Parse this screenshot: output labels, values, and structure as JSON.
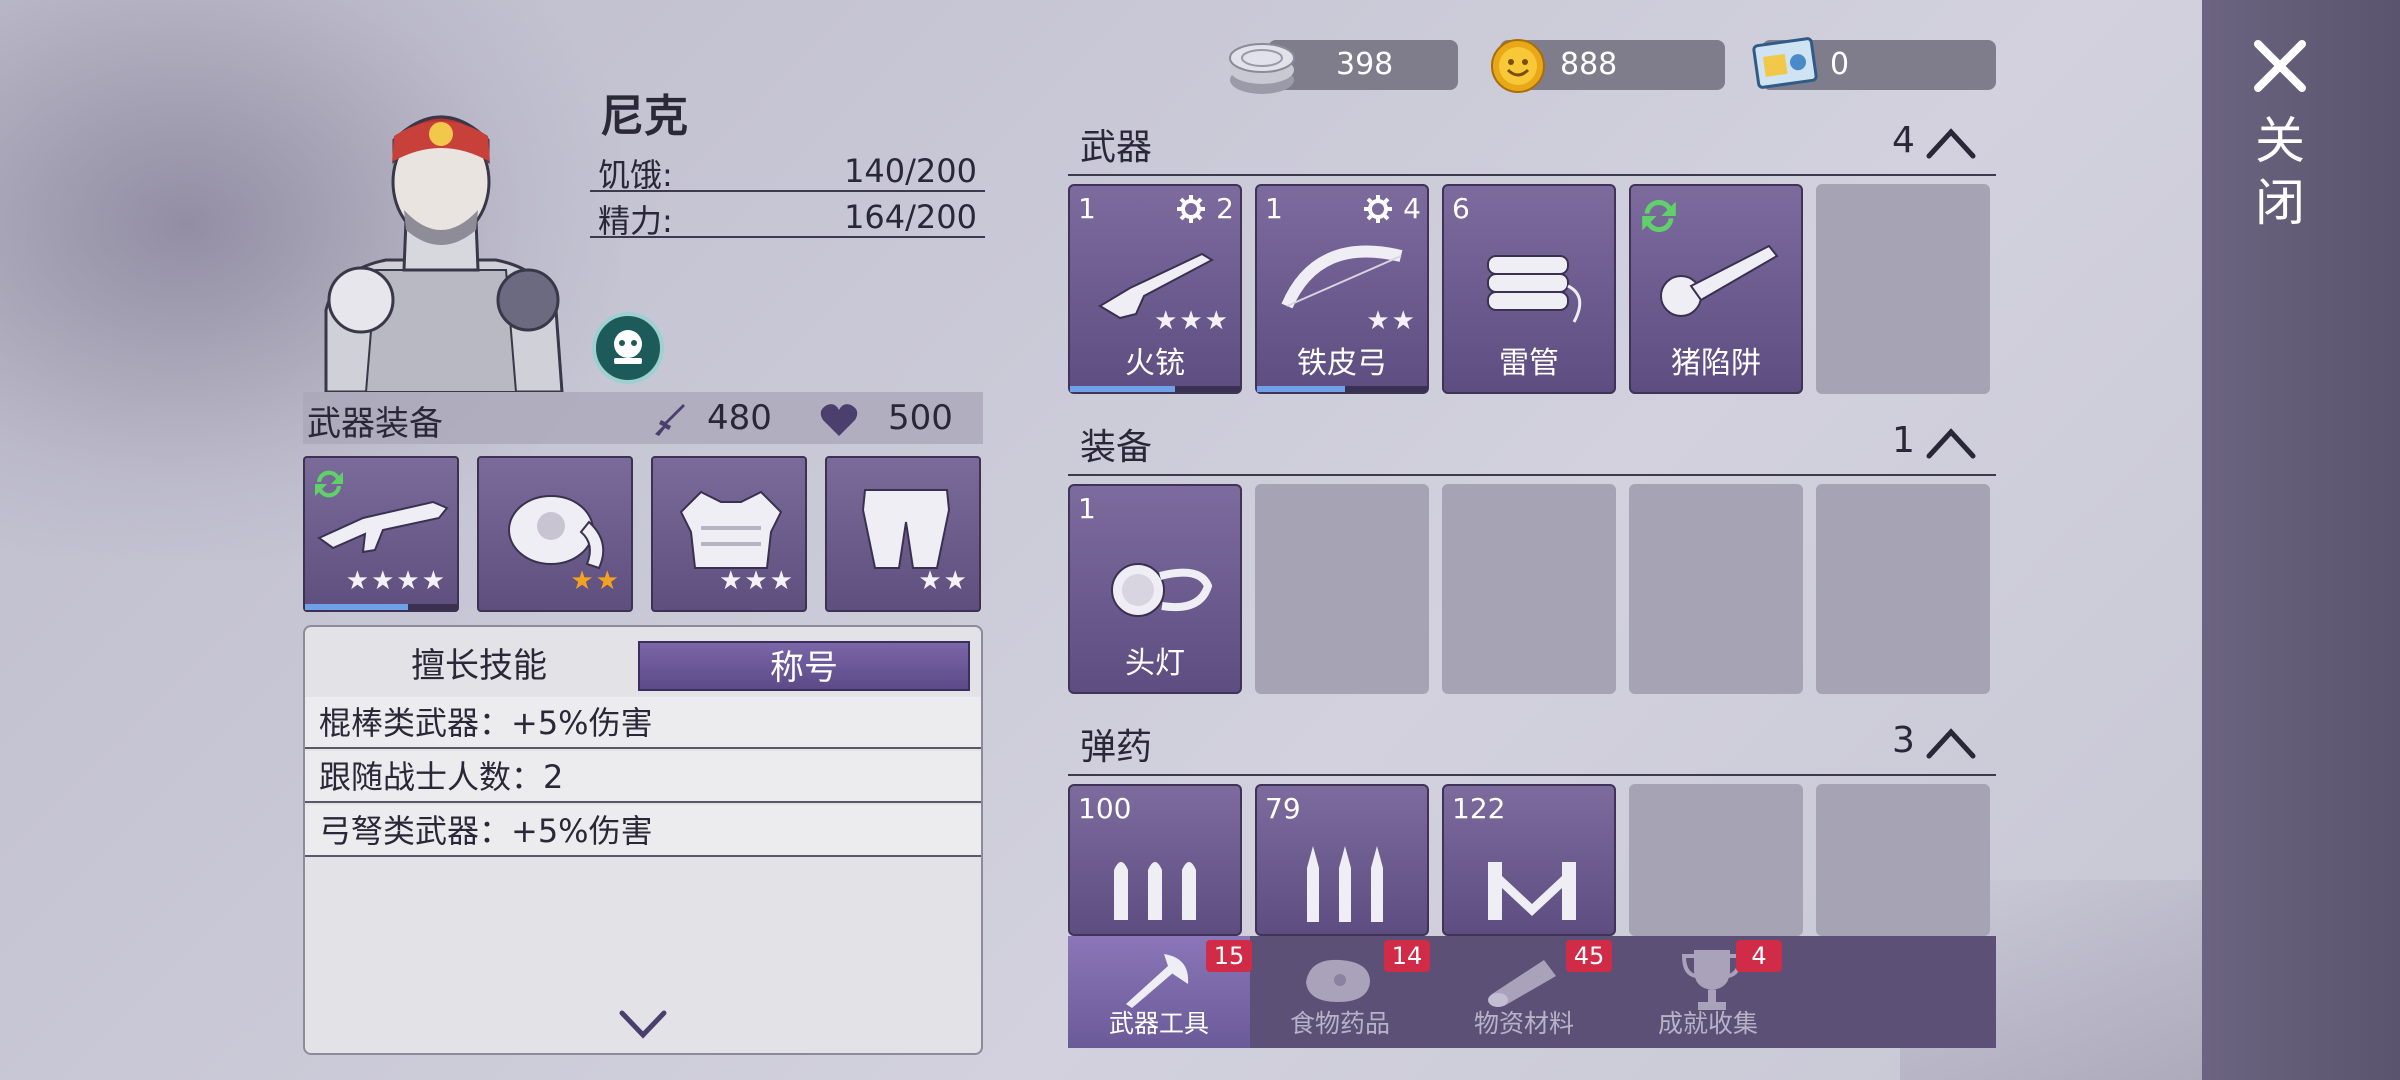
{
  "currencies": [
    {
      "name": "silver-coin",
      "value": "398"
    },
    {
      "name": "gold-coin",
      "value": "888"
    },
    {
      "name": "ticket",
      "value": "0"
    }
  ],
  "close_label": "关闭",
  "hero": {
    "name": "尼克",
    "hunger_label": "饥饿:",
    "hunger_value": "140/200",
    "energy_label": "精力:",
    "energy_value": "164/200"
  },
  "equipment": {
    "title": "武器装备",
    "attack": "480",
    "health": "500",
    "slots": [
      {
        "item": "rifle",
        "stars": "★★★★",
        "star_color": "#f0eef5",
        "progress": 0.68
      },
      {
        "item": "headband",
        "stars": "★★",
        "star_color": "#f2a21e"
      },
      {
        "item": "vest",
        "stars": "★★★",
        "star_color": "#f0eef5"
      },
      {
        "item": "pants",
        "stars": "★★",
        "star_color": "#f0eef5"
      }
    ]
  },
  "skills_panel": {
    "tab_skills": "擅长技能",
    "tab_title": "称号",
    "rows": [
      "棍棒类武器：+5%伤害",
      "跟随战士人数：2",
      "弓弩类武器：+5%伤害"
    ]
  },
  "inventory": {
    "weapons": {
      "title": "武器",
      "count": "4",
      "items": [
        {
          "num": "1",
          "level": "2",
          "name": "火铳",
          "stars": "★★★",
          "progress": 0.62
        },
        {
          "num": "1",
          "level": "4",
          "name": "铁皮弓",
          "stars": "★★",
          "progress": 0.52
        },
        {
          "num": "6",
          "name": "雷管"
        },
        {
          "name": "猪陷阱"
        }
      ]
    },
    "gear": {
      "title": "装备",
      "count": "1",
      "items": [
        {
          "num": "1",
          "name": "头灯"
        }
      ]
    },
    "ammo": {
      "title": "弹药",
      "count": "3",
      "items": [
        {
          "num": "100"
        },
        {
          "num": "79"
        },
        {
          "num": "122"
        }
      ]
    }
  },
  "nav": [
    {
      "label": "武器工具",
      "badge": "15",
      "icon": "axe-icon"
    },
    {
      "label": "食物药品",
      "badge": "14",
      "icon": "meat-icon"
    },
    {
      "label": "物资材料",
      "badge": "45",
      "icon": "log-icon"
    },
    {
      "label": "成就收集",
      "badge": "4",
      "icon": "trophy-icon"
    }
  ]
}
